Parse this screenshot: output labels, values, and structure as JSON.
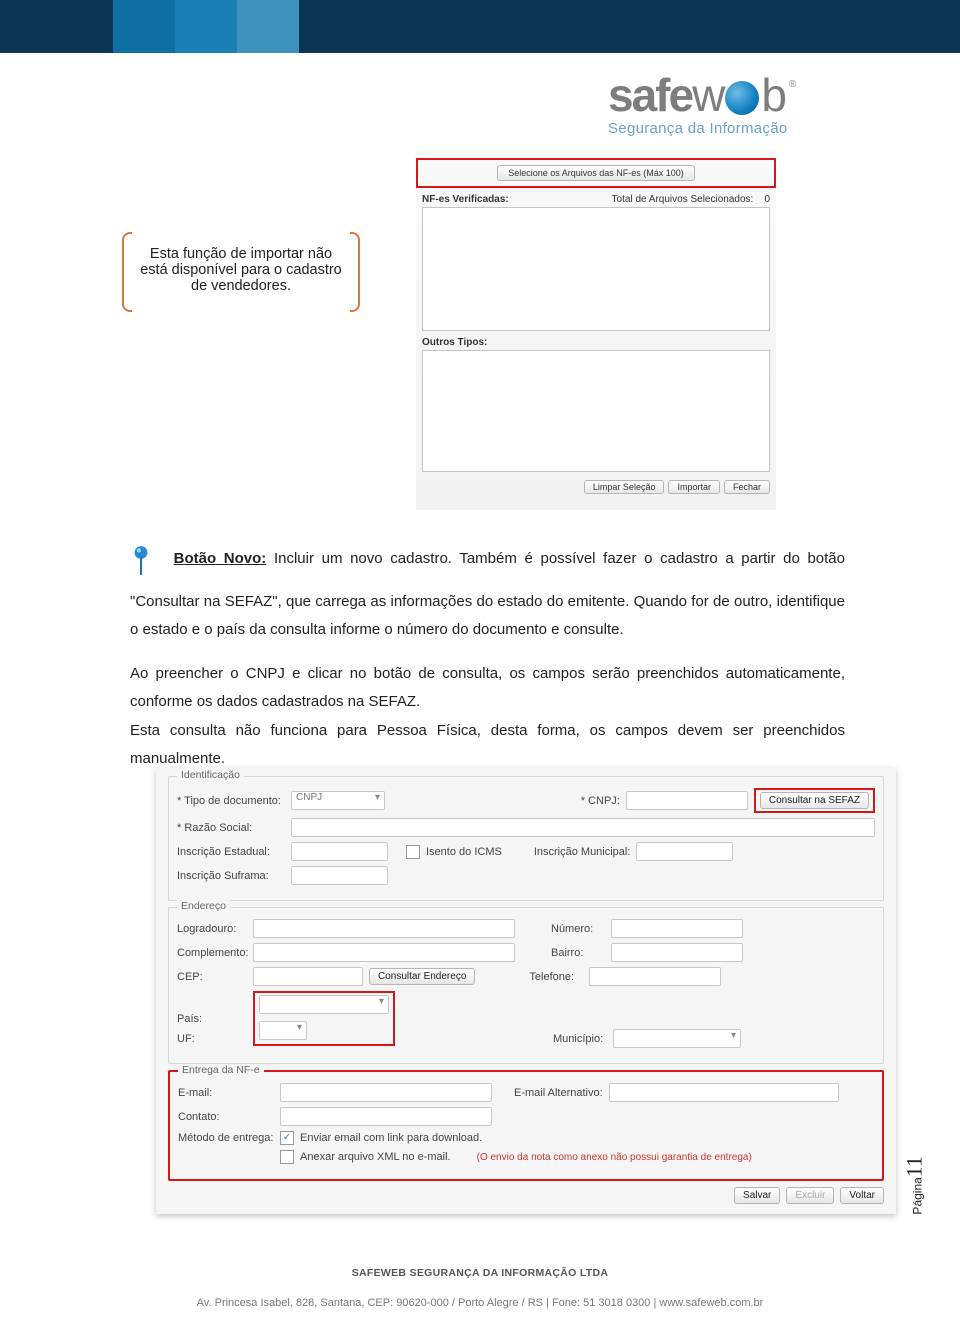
{
  "logo": {
    "pre": "safe",
    "post": "w",
    "tail": "b",
    "tagline": "Segurança da Informação"
  },
  "callout": "Esta função de importar não está disponível para o cadastro de vendedores.",
  "import": {
    "select_btn": "Selecione os Arquivos das NF-es (Máx 100)",
    "verified_label": "NF-es Verificadas:",
    "total_label": "Total de Arquivos Selecionados:",
    "total_value": "0",
    "other_label": "Outros Tipos:",
    "buttons": {
      "clear": "Limpar Seleção",
      "import": "Importar",
      "close": "Fechar"
    }
  },
  "body": {
    "lead_label": "Botão Novo:",
    "p1": " Incluir um novo cadastro. Também é possível fazer o cadastro a partir do botão \"Consultar na SEFAZ\", que carrega as informações do estado do emitente. Quando for de outro, identifique o estado e o país da consulta informe o número do documento e consulte.",
    "p2": "Ao preencher o CNPJ e clicar no botão de consulta, os campos serão preenchidos automaticamente, conforme os dados cadastrados na SEFAZ.",
    "p3": "Esta consulta não funciona para Pessoa Física, desta forma, os campos devem ser preenchidos manualmente."
  },
  "form": {
    "ident": {
      "legend": "Identificação",
      "tipo_doc": "* Tipo de documento:",
      "tipo_doc_val": "CNPJ",
      "cnpj": "* CNPJ:",
      "consultar": "Consultar na SEFAZ",
      "razao": "* Razão Social:",
      "insc_est": "Inscrição Estadual:",
      "isento": "Isento do ICMS",
      "insc_mun": "Inscrição Municipal:",
      "insc_suf": "Inscrição Suframa:"
    },
    "end": {
      "legend": "Endereço",
      "logradouro": "Logradouro:",
      "numero": "Número:",
      "complemento": "Complemento:",
      "bairro": "Bairro:",
      "cep": "CEP:",
      "consultar_end": "Consultar Endereço",
      "telefone": "Telefone:",
      "pais": "País:",
      "uf": "UF:",
      "municipio": "Município:"
    },
    "entrega": {
      "legend": "Entrega da NF-e",
      "email": "E-mail:",
      "email_alt": "E-mail Alternativo:",
      "contato": "Contato:",
      "metodo": "Método de entrega:",
      "opt1": "Enviar email com link para download.",
      "opt2": "Anexar arquivo XML no e-mail.",
      "warn": "(O envio da nota como anexo não possui garantia de entrega)"
    },
    "actions": {
      "salvar": "Salvar",
      "excluir": "Excluir",
      "voltar": "Voltar"
    }
  },
  "pagenum": {
    "label": "Página",
    "n": "11"
  },
  "footer": {
    "company": "SAFEWEB SEGURANÇA DA INFORMAÇÃO LTDA",
    "address": "Av. Princesa Isabel, 828, Santana, CEP: 90620-000 / Porto Alegre / RS  |  Fone: 51 3018 0300  |  www.safeweb.com.br"
  }
}
